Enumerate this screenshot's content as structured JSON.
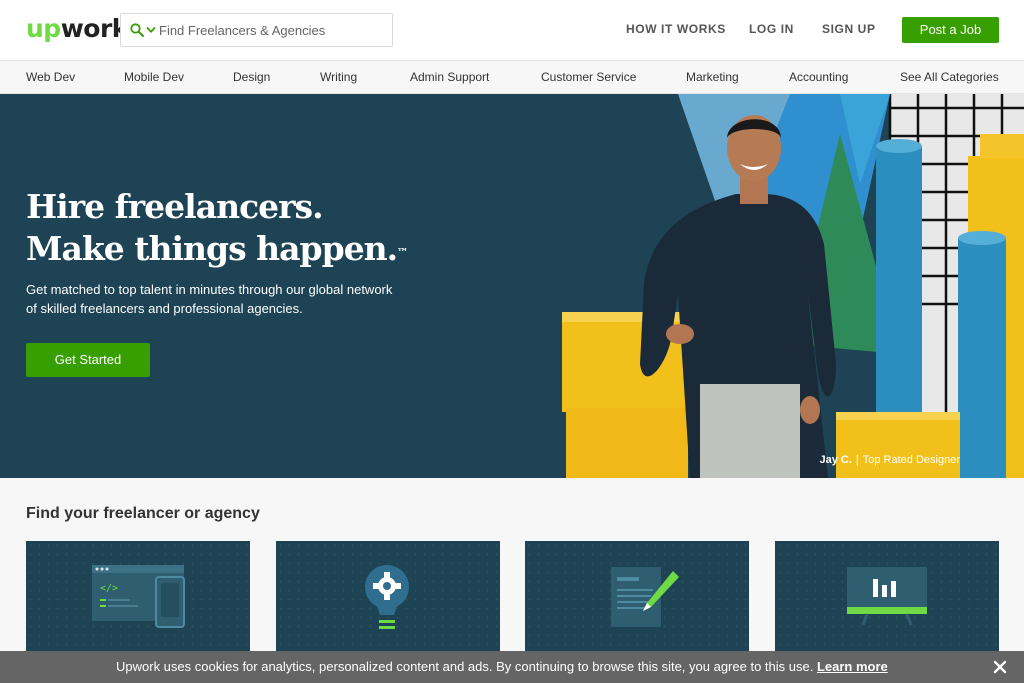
{
  "header": {
    "logo_up": "up",
    "logo_work": "work",
    "search_placeholder": "Find Freelancers & Agencies",
    "nav": [
      "HOW IT WORKS",
      "LOG IN",
      "SIGN UP"
    ],
    "post_job": "Post a Job"
  },
  "categories": [
    "Web Dev",
    "Mobile Dev",
    "Design",
    "Writing",
    "Admin Support",
    "Customer Service",
    "Marketing",
    "Accounting",
    "See All Categories"
  ],
  "hero": {
    "title_line1": "Hire freelancers.",
    "title_line2": "Make things happen.",
    "trademark": "™",
    "subtitle": "Get matched to top talent in minutes through our global network of skilled freelancers and professional agencies.",
    "cta": "Get Started",
    "caption_name": "Jay C.",
    "caption_sep": "|",
    "caption_role": "Top Rated Designer"
  },
  "find": {
    "title": "Find your freelancer or agency",
    "cards": [
      "code-monitor-icon",
      "gear-lightbulb-icon",
      "document-pen-icon",
      "chart-board-icon"
    ]
  },
  "cookie": {
    "text": "Upwork uses cookies for analytics, personalized content and ads. By continuing to browse this site, you agree to this use.",
    "link": "Learn more"
  },
  "colors": {
    "brand_green": "#37a000",
    "logo_green": "#6fda44",
    "hero_bg": "#1d4354",
    "cookie_bg": "#656565"
  }
}
